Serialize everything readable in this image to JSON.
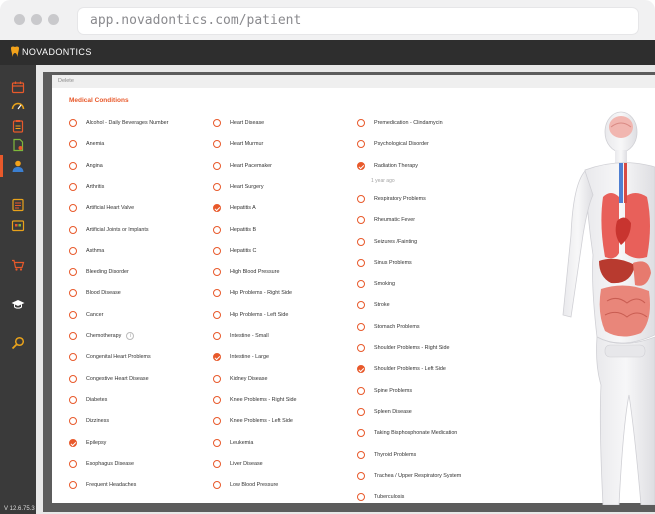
{
  "browser": {
    "url": "app.novadontics.com/patient"
  },
  "app": {
    "logo_text": "NOVADONTICS",
    "version": "V 12.6.75.3",
    "accent": "#e8592b"
  },
  "panel": {
    "breadcrumb": "Delete",
    "section_title": "Medical Conditions"
  },
  "sidebar": {
    "items": [
      "calendar-icon",
      "dashboard-icon",
      "clipboard-icon",
      "document-icon",
      "patient-icon",
      "notes-icon",
      "schedule-icon",
      "cart-icon",
      "education-icon",
      "search-icon"
    ],
    "active": "patient-icon"
  },
  "conditions": {
    "col1": [
      {
        "label": "Alcohol - Daily Beverages Number",
        "checked": false
      },
      {
        "label": "Anemia",
        "checked": false
      },
      {
        "label": "Angina",
        "checked": false
      },
      {
        "label": "Arthritis",
        "checked": false
      },
      {
        "label": "Artificial Heart Valve",
        "checked": false
      },
      {
        "label": "Artificial Joints or Implants",
        "checked": false
      },
      {
        "label": "Asthma",
        "checked": false
      },
      {
        "label": "Bleeding Disorder",
        "checked": false
      },
      {
        "label": "Blood Disease",
        "checked": false
      },
      {
        "label": "Cancer",
        "checked": false
      },
      {
        "label": "Chemotherapy",
        "checked": false,
        "info": true
      },
      {
        "label": "Congenital Heart Problems",
        "checked": false
      },
      {
        "label": "Congestive Heart Disease",
        "checked": false
      },
      {
        "label": "Diabetes",
        "checked": false
      },
      {
        "label": "Dizziness",
        "checked": false
      },
      {
        "label": "Epilepsy",
        "checked": true
      },
      {
        "label": "Esophagus Disease",
        "checked": false
      },
      {
        "label": "Frequent Headaches",
        "checked": false
      }
    ],
    "col2": [
      {
        "label": "Heart Disease",
        "checked": false
      },
      {
        "label": "Heart Murmur",
        "checked": false
      },
      {
        "label": "Heart Pacemaker",
        "checked": false
      },
      {
        "label": "Heart Surgery",
        "checked": false
      },
      {
        "label": "Hepatitis A",
        "checked": true
      },
      {
        "label": "Hepatitis B",
        "checked": false
      },
      {
        "label": "Hepatitis C",
        "checked": false
      },
      {
        "label": "High Blood Pressure",
        "checked": false
      },
      {
        "label": "Hip Problems - Right Side",
        "checked": false
      },
      {
        "label": "Hip Problems - Left Side",
        "checked": false
      },
      {
        "label": "Intestine - Small",
        "checked": false
      },
      {
        "label": "Intestine - Large",
        "checked": true
      },
      {
        "label": "Kidney Disease",
        "checked": false
      },
      {
        "label": "Knee Problems - Right Side",
        "checked": false
      },
      {
        "label": "Knee Problems - Left Side",
        "checked": false
      },
      {
        "label": "Leukemia",
        "checked": false
      },
      {
        "label": "Liver Disease",
        "checked": false
      },
      {
        "label": "Low Blood Pressure",
        "checked": false
      }
    ],
    "col3": [
      {
        "label": "Premedication - Clindamycin",
        "checked": false
      },
      {
        "label": "Psychological Disorder",
        "checked": false
      },
      {
        "label": "Radiation Therapy",
        "checked": true,
        "note": "1 year ago"
      },
      {
        "label": "Respiratory Problems",
        "checked": false
      },
      {
        "label": "Rheumatic Fever",
        "checked": false
      },
      {
        "label": "Seizures /Fainting",
        "checked": false
      },
      {
        "label": "Sinus Problems",
        "checked": false
      },
      {
        "label": "Smoking",
        "checked": false
      },
      {
        "label": "Stroke",
        "checked": false
      },
      {
        "label": "Stomach Problems",
        "checked": false
      },
      {
        "label": "Shoulder Problems - Right Side",
        "checked": false
      },
      {
        "label": "Shoulder Problems - Left Side",
        "checked": true
      },
      {
        "label": "Spine Problems",
        "checked": false
      },
      {
        "label": "Spleen Disease",
        "checked": false
      },
      {
        "label": "Taking Bisphosphonate Medication",
        "checked": false
      },
      {
        "label": "Thyroid Problems",
        "checked": false
      },
      {
        "label": "Trachea / Upper Respiratory System",
        "checked": false
      },
      {
        "label": "Tuberculosis",
        "checked": false
      }
    ]
  }
}
